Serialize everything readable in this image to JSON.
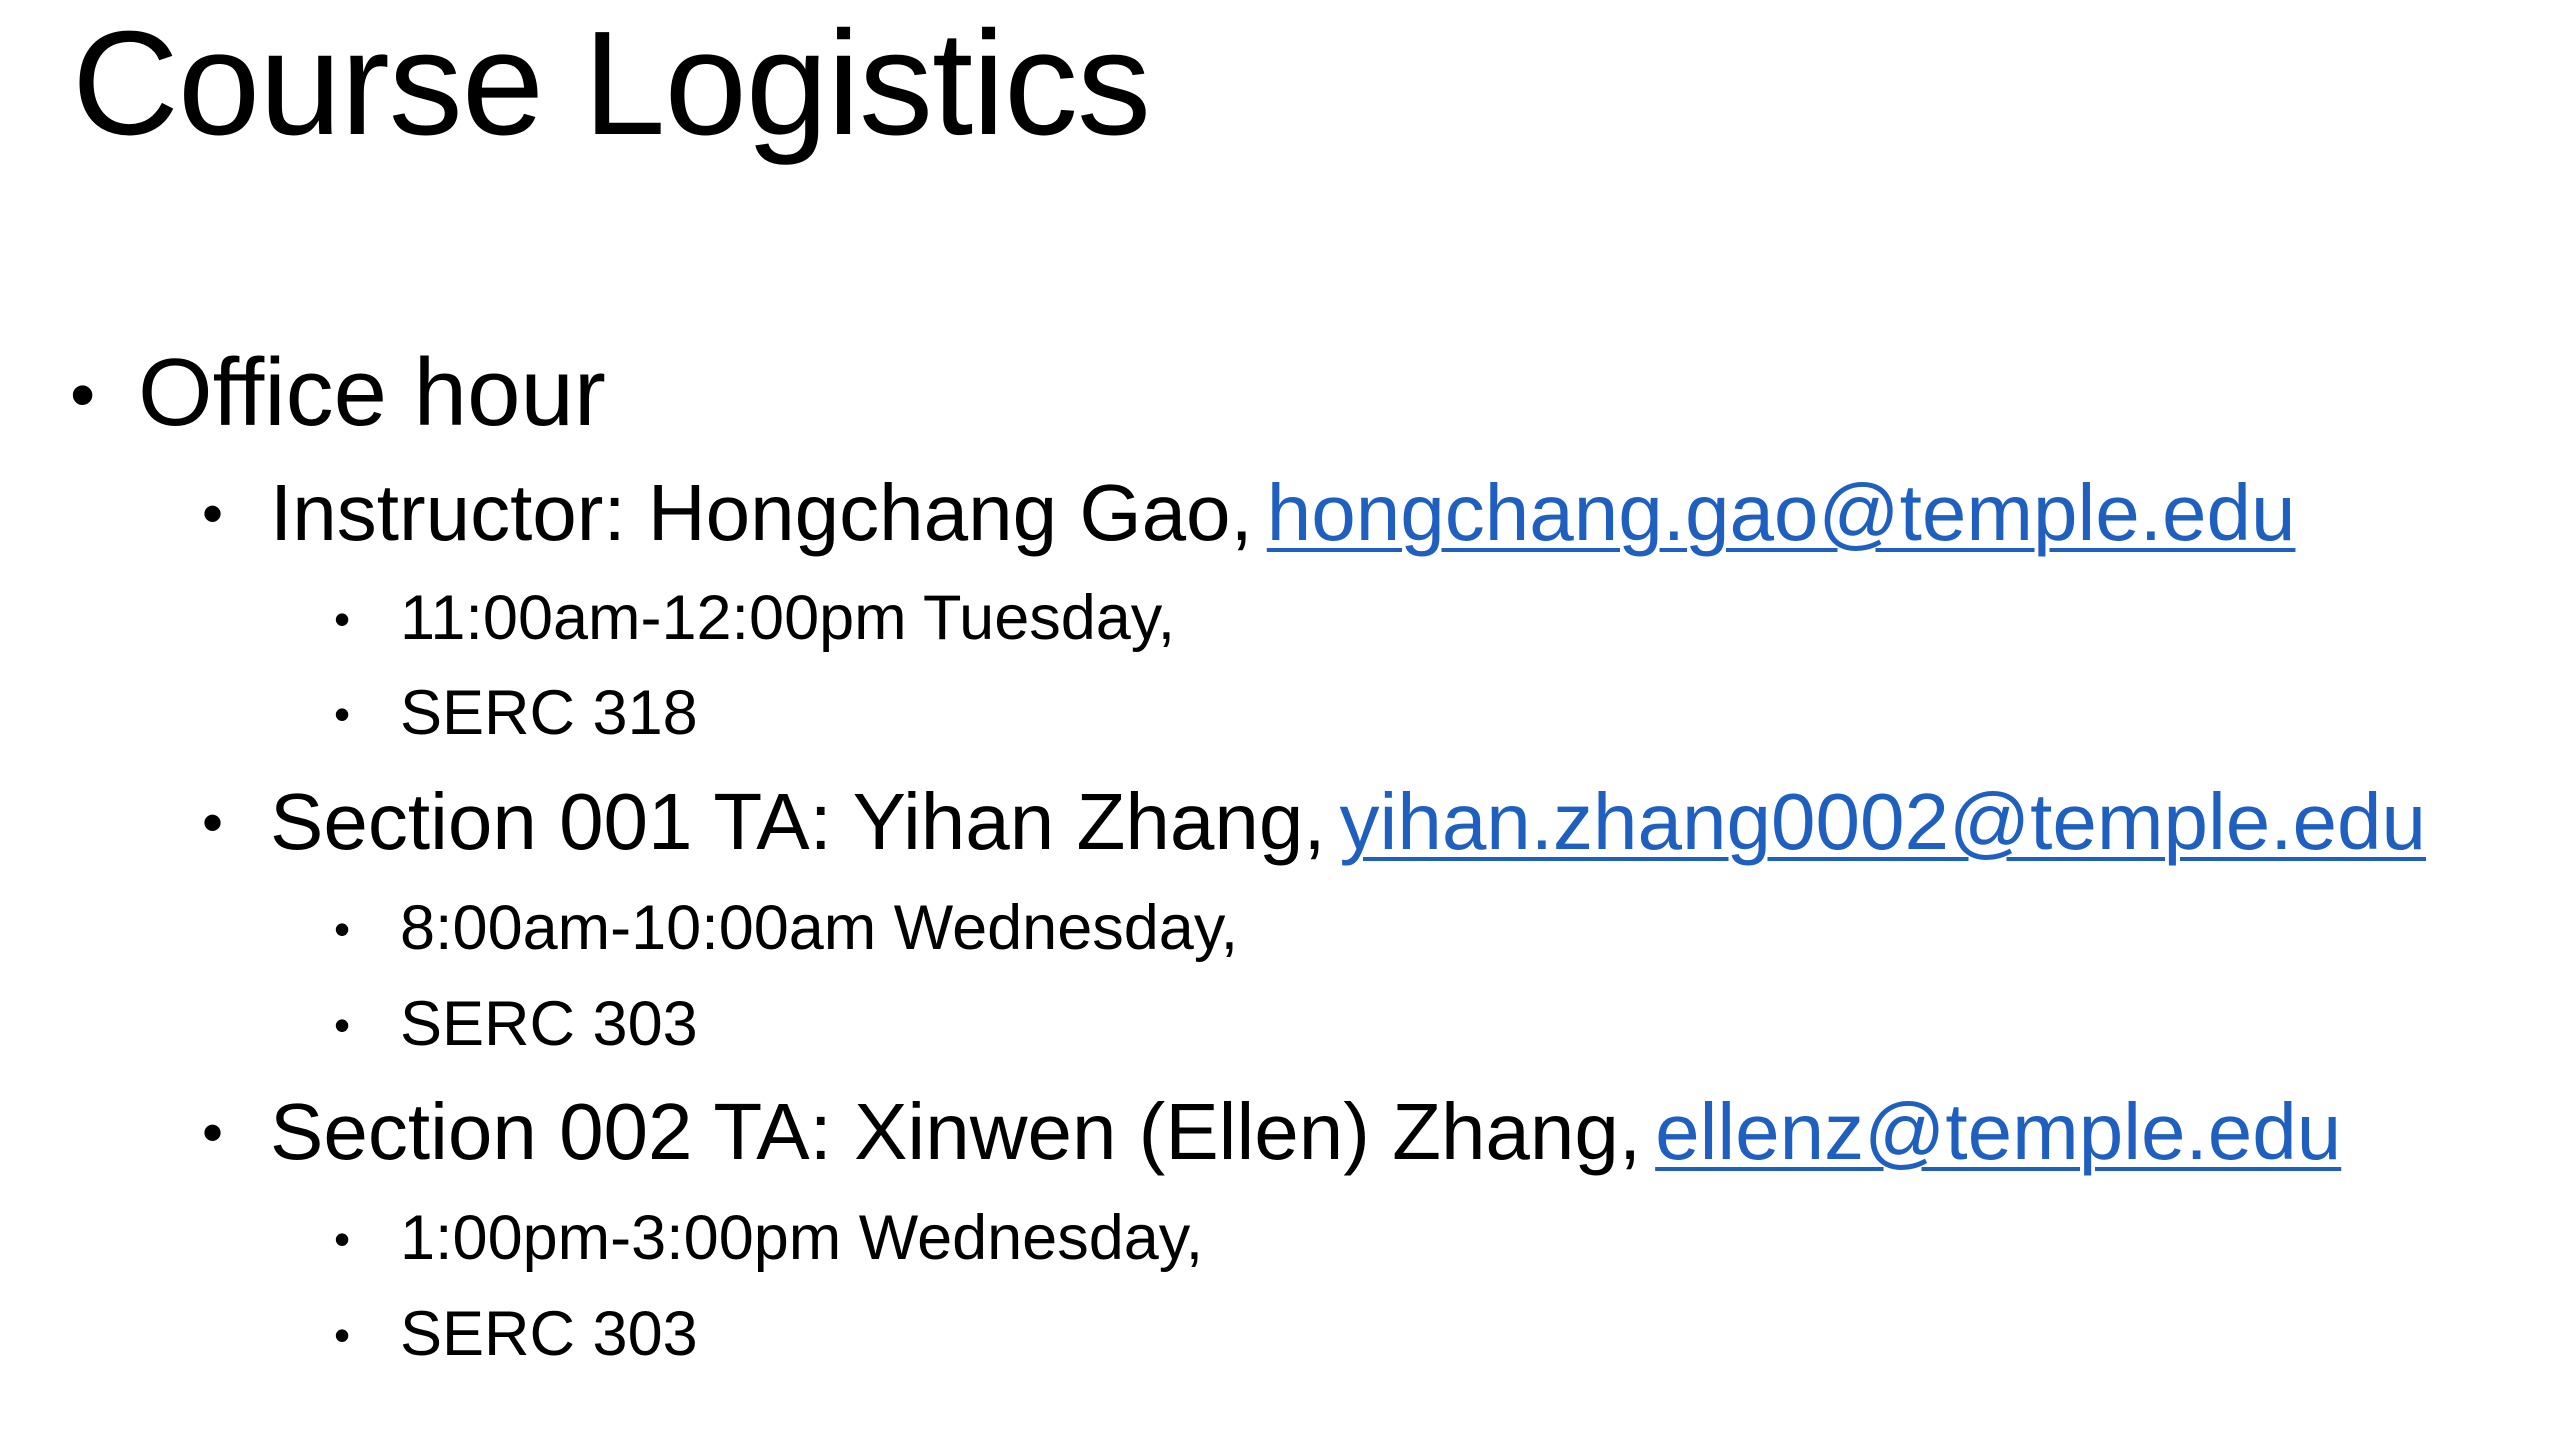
{
  "slide": {
    "title": "Course Logistics",
    "bullets": {
      "office_hour": "Office hour",
      "instructor": {
        "label": "Instructor: Hongchang Gao,",
        "email": "hongchang.gao@temple.edu",
        "time": "11:00am-12:00pm Tuesday,",
        "room": "SERC 318"
      },
      "section001": {
        "label": "Section 001 TA: Yihan Zhang,",
        "email": "yihan.zhang0002@temple.edu",
        "time": "8:00am-10:00am Wednesday,",
        "room": "SERC 303"
      },
      "section002": {
        "label": "Section 002 TA: Xinwen (Ellen) Zhang,",
        "email": "ellenz@temple.edu",
        "time": "1:00pm-3:00pm Wednesday,",
        "room": "SERC 303"
      }
    },
    "colors": {
      "text": "#000000",
      "link": "#1f5fbf",
      "background": "#ffffff"
    }
  }
}
